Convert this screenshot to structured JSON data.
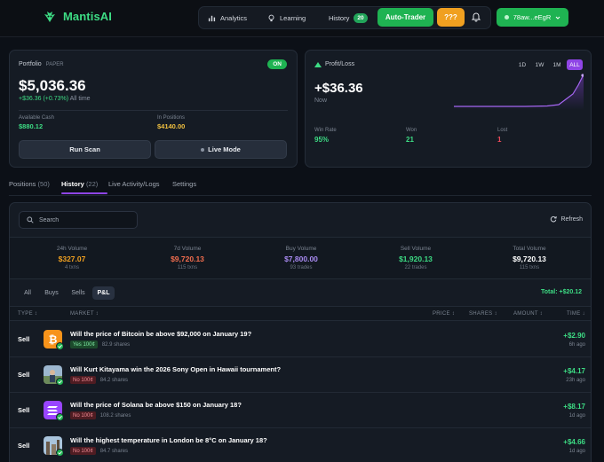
{
  "app": {
    "name": "MantisAI"
  },
  "nav": {
    "analytics": "Analytics",
    "learning": "Learning",
    "history": "History",
    "history_count": "20",
    "auto_trader": "Auto-Trader",
    "unknown_button": "???",
    "wallet": "78aw...eEgR"
  },
  "portfolio": {
    "label": "Portfolio",
    "mode": "PAPER",
    "status": "ON",
    "value": "$5,036.36",
    "change": "+$36.36 (+0.73%)",
    "change_period": "All time",
    "available_cash_label": "Available Cash",
    "available_cash": "$880.12",
    "in_positions_label": "In Positions",
    "in_positions": "$4140.00",
    "run_scan": "Run Scan",
    "live_mode": "Live Mode"
  },
  "pnl": {
    "label": "Profit/Loss",
    "ranges": [
      "1D",
      "1W",
      "1M",
      "ALL"
    ],
    "active_range": "ALL",
    "value": "+$36.36",
    "now": "Now",
    "win_rate_label": "Win Rate",
    "win_rate": "95%",
    "won_label": "Won",
    "won": "21",
    "lost_label": "Lost",
    "lost": "1",
    "accent_color": "#8f45e6"
  },
  "tabs": [
    {
      "label": "Positions",
      "count": "(50)"
    },
    {
      "label": "History",
      "count": "(22)"
    },
    {
      "label": "Live Activity/Logs",
      "count": ""
    },
    {
      "label": "Settings",
      "count": ""
    }
  ],
  "history": {
    "search_placeholder": "Search",
    "refresh": "Refresh",
    "volumes": [
      {
        "label": "24h Volume",
        "value": "$327.07",
        "sub": "4 txns",
        "color": "#f0a020"
      },
      {
        "label": "7d Volume",
        "value": "$9,720.13",
        "sub": "115 txns",
        "color": "#f26d4e"
      },
      {
        "label": "Buy Volume",
        "value": "$7,800.00",
        "sub": "93 trades",
        "color": "#a98bf2"
      },
      {
        "label": "Sell Volume",
        "value": "$1,920.13",
        "sub": "22 trades",
        "color": "#3ddc84"
      },
      {
        "label": "Total Volume",
        "value": "$9,720.13",
        "sub": "115 txns",
        "color": "#ffffff"
      }
    ],
    "filters": [
      "All",
      "Buys",
      "Sells",
      "P&L"
    ],
    "active_filter": "P&L",
    "total": "Total: +$20.12",
    "columns": {
      "type": "TYPE",
      "market": "MARKET",
      "price": "PRICE",
      "shares": "SHARES",
      "amount": "AMOUNT",
      "time": "TIME"
    },
    "rows": [
      {
        "type": "Sell",
        "icon": "bitcoin-icon",
        "market": "Will the price of Bitcoin be above $92,000 on January 19?",
        "side": "Yes 100¢",
        "side_kind": "yes",
        "shares": "82.9 shares",
        "amount": "+$2.90",
        "ago": "6h ago"
      },
      {
        "type": "Sell",
        "icon": "photo-thumbnail-icon",
        "market": "Will Kurt Kitayama win the 2026 Sony Open in Hawaii tournament?",
        "side": "No 100¢",
        "side_kind": "no",
        "shares": "84.2 shares",
        "amount": "+$4.17",
        "ago": "23h ago"
      },
      {
        "type": "Sell",
        "icon": "solana-icon",
        "market": "Will the price of Solana be above $150 on January 18?",
        "side": "No 100¢",
        "side_kind": "no",
        "shares": "108.2 shares",
        "amount": "+$8.17",
        "ago": "1d ago"
      },
      {
        "type": "Sell",
        "icon": "photo-thumbnail-icon",
        "market": "Will the highest temperature in London be 8°C on January 18?",
        "side": "No 100¢",
        "side_kind": "no",
        "shares": "84.7 shares",
        "amount": "+$4.66",
        "ago": "1d ago"
      }
    ]
  }
}
